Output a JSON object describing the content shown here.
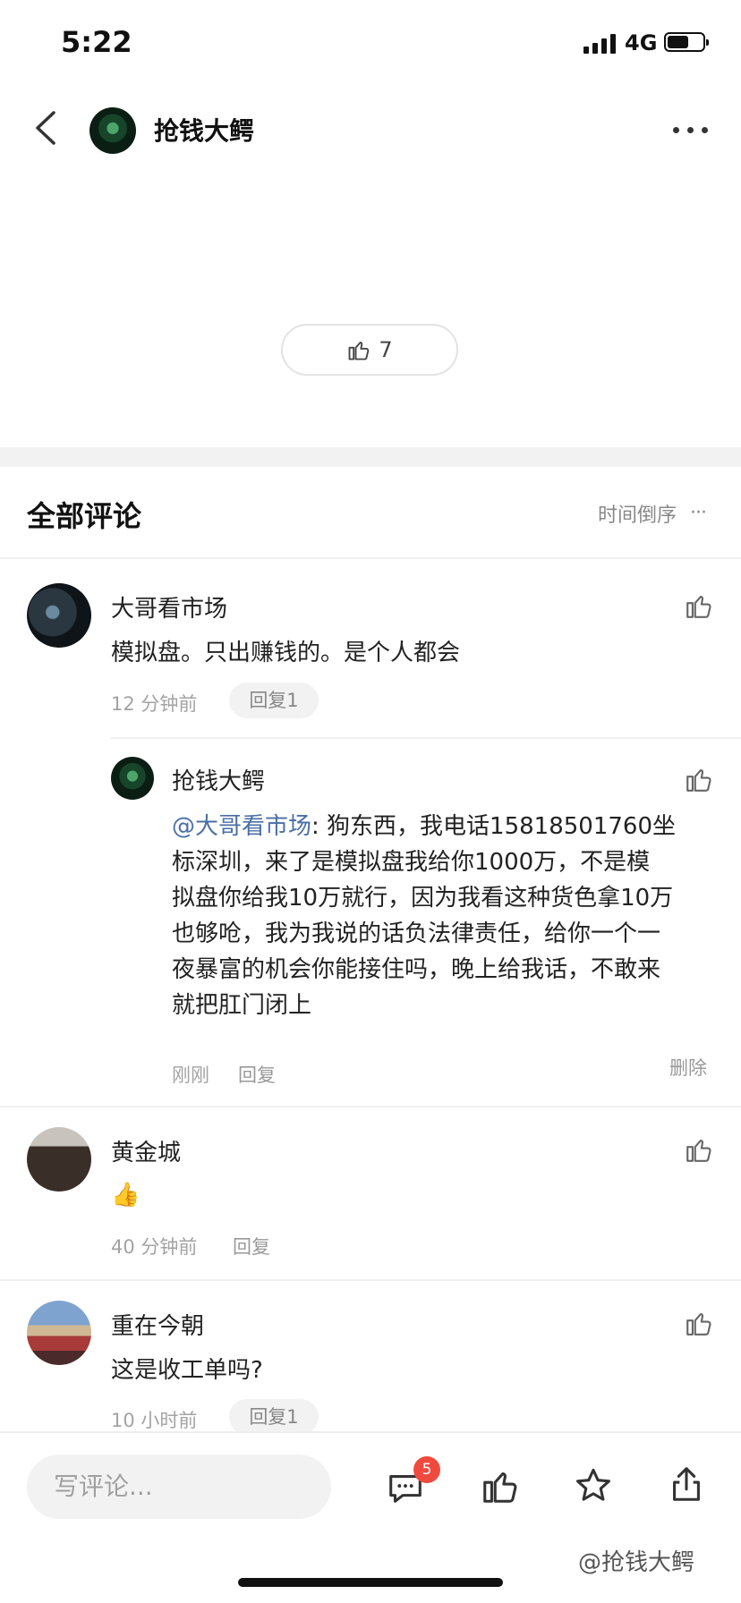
{
  "status": {
    "time": "5:22",
    "network": "4G",
    "battery_level": 0.6
  },
  "header": {
    "name": "抢钱大鳄"
  },
  "post": {
    "like_count": "7"
  },
  "comments_section": {
    "title": "全部评论",
    "sort_label": "时间倒序",
    "sort_more": "···"
  },
  "comments": [
    {
      "name": "大哥看市场",
      "text": "模拟盘。只出赚钱的。是个人都会",
      "time": "12 分钟前",
      "reply_label": "回复1",
      "reply": {
        "name": "抢钱大鳄",
        "mention": "@大哥看市场",
        "lines": [
          ": 狗东西，我电话15818501760坐",
          "标深圳，来了是模拟盘我给你1000万，不是模",
          "拟盘你给我10万就行，因为我看这种货色拿10万",
          "也够呛，我为我说的话负法律责任，给你一个一",
          "夜暴富的机会你能接住吗，晚上给我话，不敢来",
          "就把肛门闭上"
        ],
        "time": "刚刚",
        "reply_label": "回复",
        "delete_label": "删除"
      }
    },
    {
      "name": "黄金城",
      "text": "👍",
      "time": "40 分钟前",
      "reply_label": "回复"
    },
    {
      "name": "重在今朝",
      "text": "这是收工单吗?",
      "time": "10 小时前",
      "reply_label": "回复1"
    }
  ],
  "bottom_bar": {
    "placeholder": "写评论...",
    "comment_badge": "5"
  },
  "watermark": "@抢钱大鳄"
}
